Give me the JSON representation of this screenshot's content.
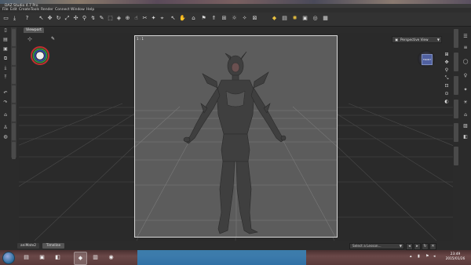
{
  "window": {
    "title": "DAZ Studio 4.7 Pro"
  },
  "menu": [
    "File",
    "Edit",
    "Create",
    "Tools",
    "Render",
    "Connect",
    "Window",
    "Help"
  ],
  "viewport": {
    "tab_label": "Viewport",
    "frame_label": "1 : 1",
    "camera_select": "Perspective View",
    "viewcube_label": "FRONT"
  },
  "bottom_tabs": [
    "aniMate2",
    "Timeline"
  ],
  "lesson": {
    "placeholder": "Select a Lesson..."
  },
  "taskbar": {
    "clock_time": "23:49",
    "clock_date": "2015/01/26"
  },
  "icons": {
    "toolbar": [
      "new-file-icon",
      "open-icon",
      "help-icon",
      "select-icon",
      "move-icon",
      "rotate-icon",
      "scale-icon",
      "universal-icon",
      "joint-editor-icon",
      "bend-icon",
      "node-weight-icon",
      "surface-selection-icon",
      "geometry-editor-icon",
      "region-nav-icon",
      "posing-icon",
      "render-icon",
      "light-icon",
      "camera-icon",
      "environment-icon",
      "figure-icon",
      "pointer-icon",
      "hand-icon",
      "arrow-up-icon",
      "lock-icon",
      "spot-render-icon",
      "render-settings-icon",
      "camera-render-icon",
      "save-render-icon"
    ]
  }
}
